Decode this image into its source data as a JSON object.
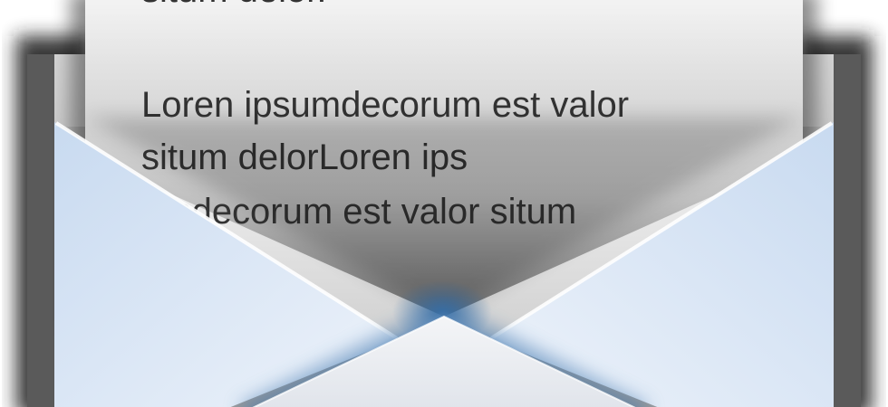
{
  "envelope_icon": {
    "icon": "open-envelope-icon",
    "letter": {
      "line_top": "situm delor.",
      "line_1": "Loren ipsumdecorum est valor",
      "line_2": "situm delorLoren ips",
      "line_3": "umdecorum est valor situm"
    },
    "colors": {
      "paper": "#f4f4f4",
      "text": "#333333",
      "envelope_light": "#e4edf8",
      "envelope_blue": "#c9dbef",
      "seam_blue": "#4a7aab",
      "frame_shadow": "#2a2a2a"
    }
  }
}
